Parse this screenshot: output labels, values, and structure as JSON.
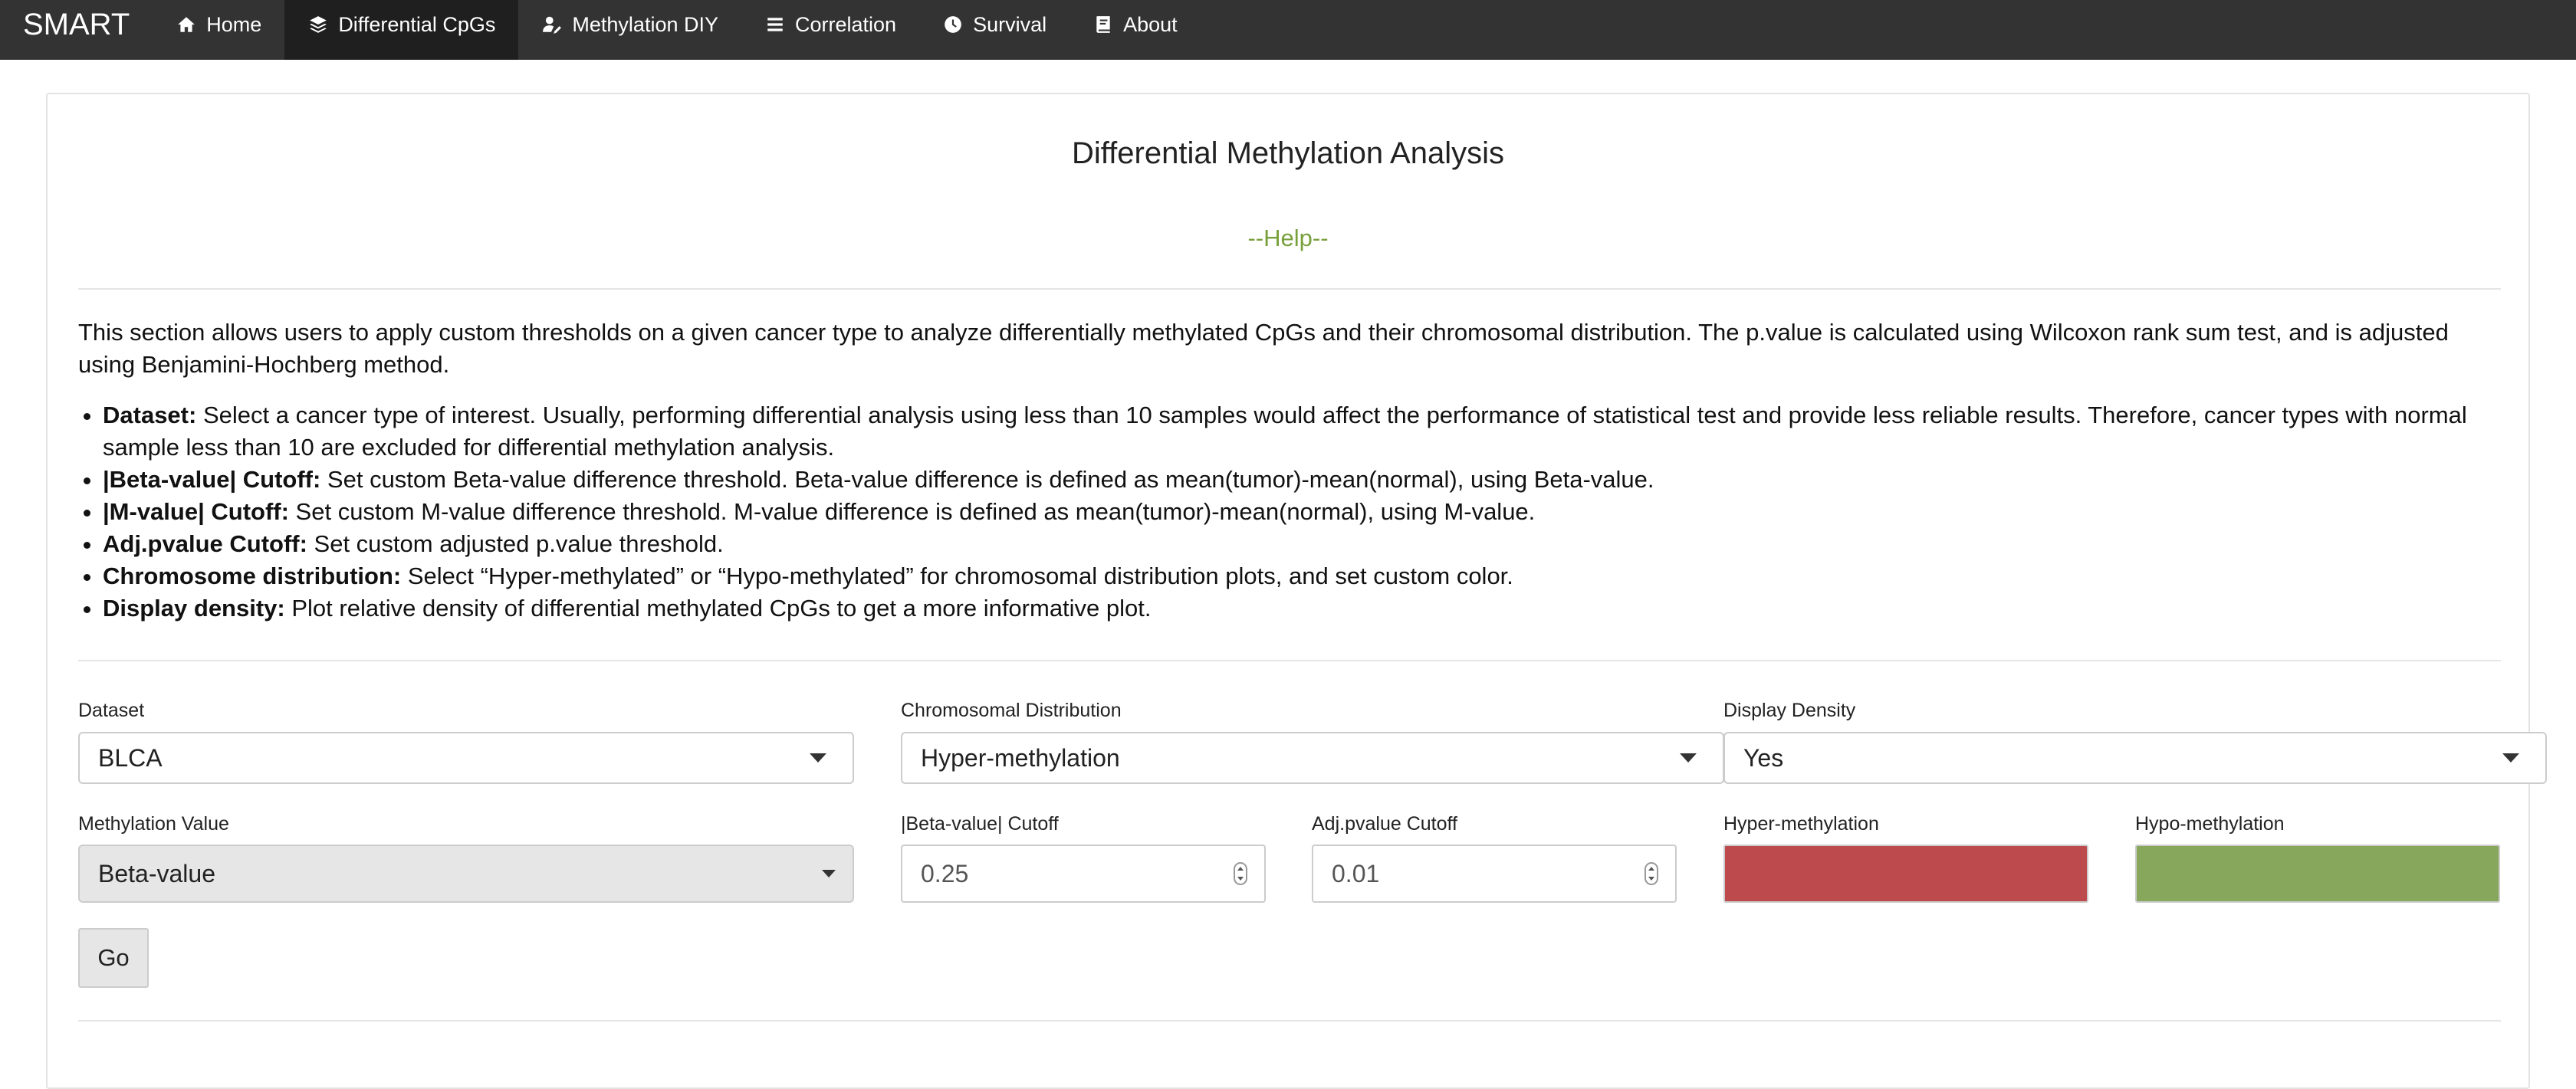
{
  "navbar": {
    "brand": "SMART",
    "items": [
      {
        "label": "Home",
        "icon": "home-icon",
        "active": false
      },
      {
        "label": "Differential CpGs",
        "icon": "layers-icon",
        "active": true
      },
      {
        "label": "Methylation DIY",
        "icon": "user-edit-icon",
        "active": false
      },
      {
        "label": "Correlation",
        "icon": "list-icon",
        "active": false
      },
      {
        "label": "Survival",
        "icon": "clock-icon",
        "active": false
      },
      {
        "label": "About",
        "icon": "book-icon",
        "active": false
      }
    ]
  },
  "main": {
    "title": "Differential Methylation Analysis",
    "help": "--Help--",
    "intro": "This section allows users to apply custom thresholds on a given cancer type to analyze differentially methylated CpGs and their chromosomal distribution. The p.value is calculated using Wilcoxon rank sum test, and is adjusted using Benjamini-Hochberg method.",
    "bullets": [
      {
        "term": "Dataset:",
        "text": " Select a cancer type of interest. Usually, performing differential analysis using less than 10 samples would affect the performance of statistical test and provide less reliable results. Therefore, cancer types with normal sample less than 10 are excluded for differential methylation analysis."
      },
      {
        "term": "|Beta-value| Cutoff:",
        "text": " Set custom Beta-value difference threshold. Beta-value difference is defined as mean(tumor)-mean(normal), using Beta-value."
      },
      {
        "term": "|M-value| Cutoff:",
        "text": " Set custom M-value difference threshold. M-value difference is defined as mean(tumor)-mean(normal), using M-value."
      },
      {
        "term": "Adj.pvalue Cutoff:",
        "text": " Set custom adjusted p.value threshold."
      },
      {
        "term": "Chromosome distribution:",
        "text": " Select “Hyper-methylated” or “Hypo-methylated” for chromosomal distribution plots, and set custom color."
      },
      {
        "term": "Display density:",
        "text": " Plot relative density of differential methylated CpGs to get a more informative plot."
      }
    ]
  },
  "form": {
    "dataset": {
      "label": "Dataset",
      "value": "BLCA"
    },
    "chrom_dist": {
      "label": "Chromosomal Distribution",
      "value": "Hyper-methylation"
    },
    "density": {
      "label": "Display Density",
      "value": "Yes"
    },
    "meth_value": {
      "label": "Methylation Value",
      "value": "Beta-value"
    },
    "beta_cutoff": {
      "label": "|Beta-value| Cutoff",
      "value": "0.25"
    },
    "adj_cutoff": {
      "label": "Adj.pvalue Cutoff",
      "value": "0.01"
    },
    "hyper_color": {
      "label": "Hyper-methylation",
      "color": "#bd4a4c"
    },
    "hypo_color": {
      "label": "Hypo-methylation",
      "color": "#86a75c"
    },
    "go_label": "Go"
  }
}
